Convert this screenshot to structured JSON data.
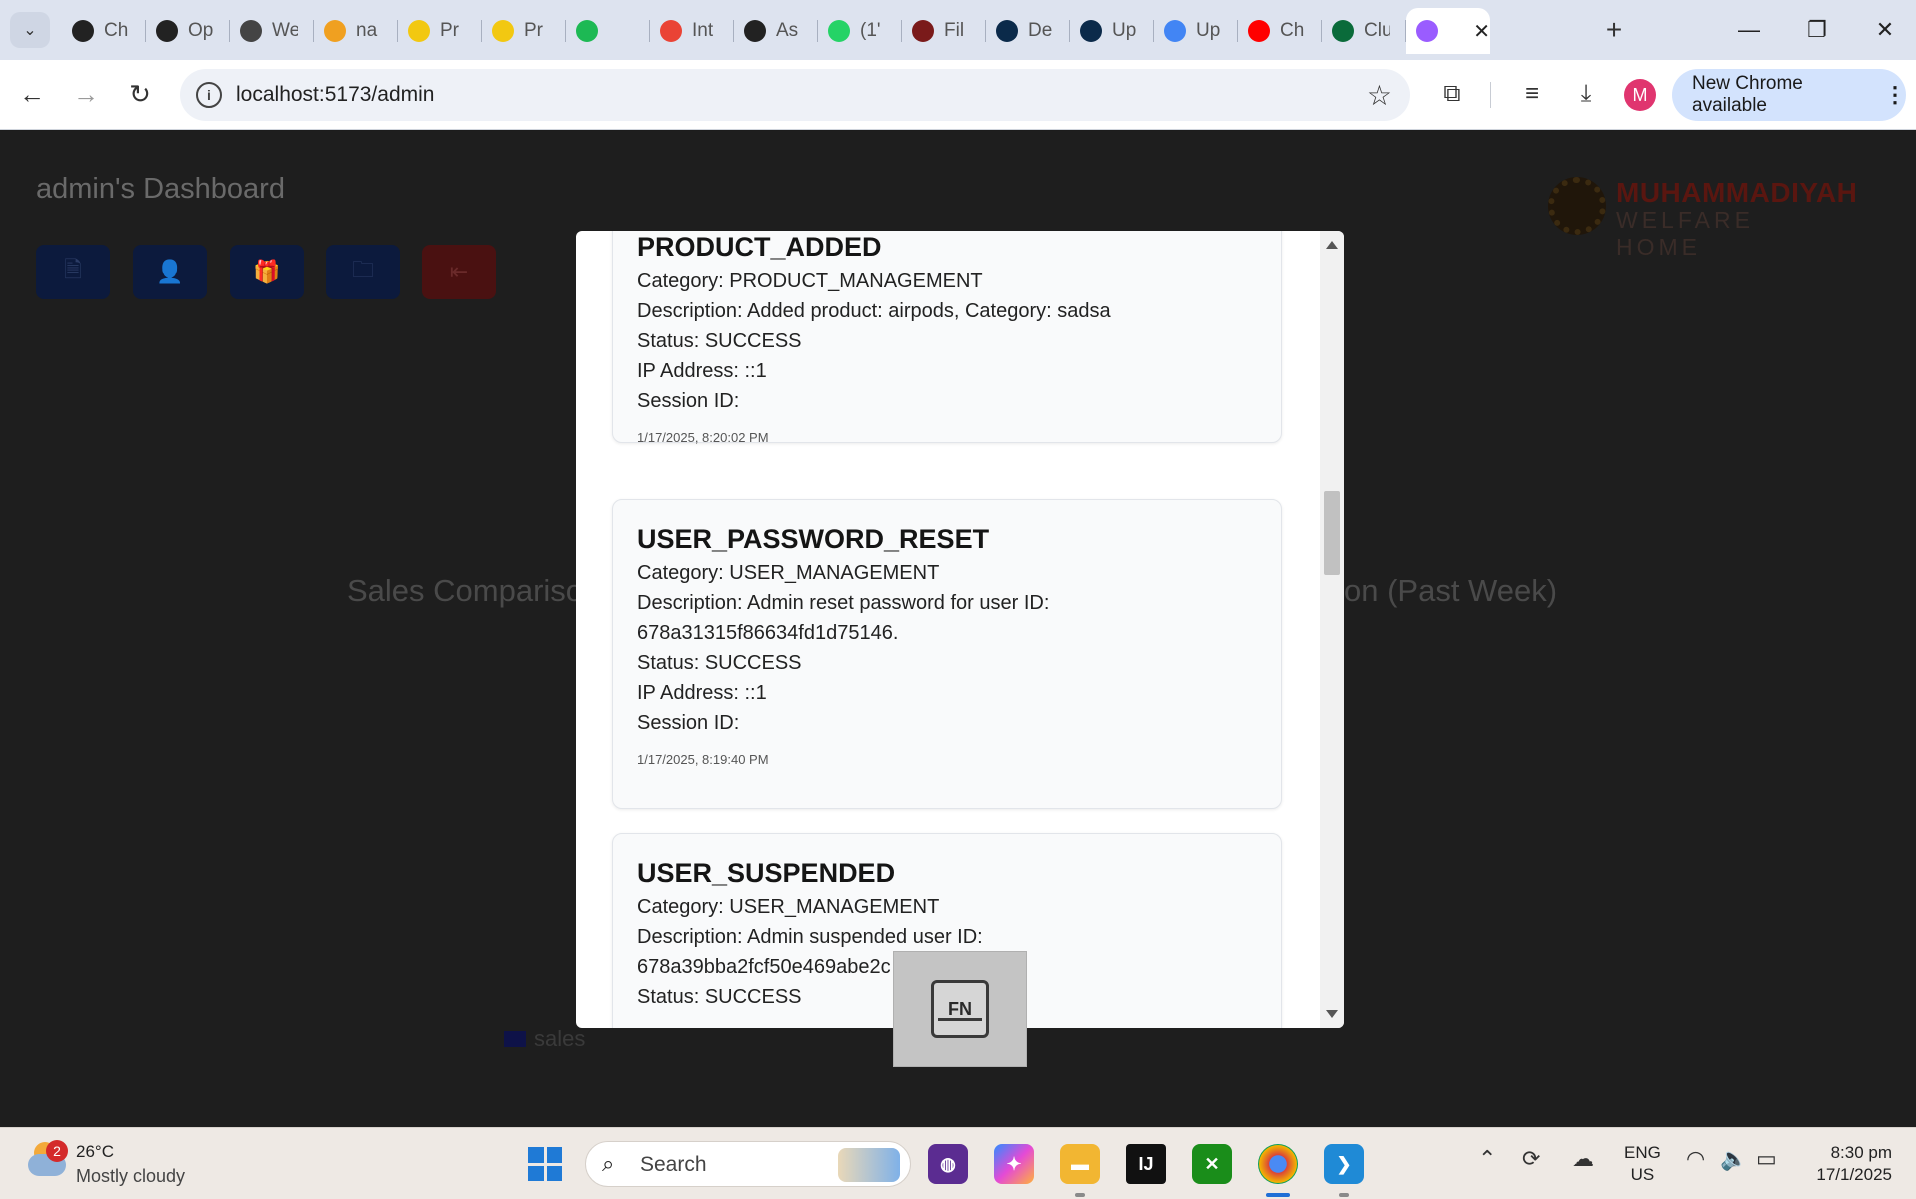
{
  "browser": {
    "tabs": [
      {
        "title": "Ch",
        "icon": "openai-icon",
        "color": "#222222"
      },
      {
        "title": "Op",
        "icon": "openai-icon",
        "color": "#222222"
      },
      {
        "title": "We",
        "icon": "globe-icon",
        "color": "#444444"
      },
      {
        "title": "na",
        "icon": "leetcode-icon",
        "color": "#f0a020"
      },
      {
        "title": "Pr",
        "icon": "powerbi-icon",
        "color": "#f2c811"
      },
      {
        "title": "Pr",
        "icon": "powerbi-icon",
        "color": "#f2c811"
      },
      {
        "title": "",
        "icon": "spotify-icon",
        "color": "#1db954"
      },
      {
        "title": "Int",
        "icon": "gmail-icon",
        "color": "#ea4335"
      },
      {
        "title": "As",
        "icon": "app-icon",
        "color": "#222222"
      },
      {
        "title": "(1'",
        "icon": "whatsapp-icon",
        "color": "#25d366"
      },
      {
        "title": "Fil",
        "icon": "school-icon",
        "color": "#7a1a1a"
      },
      {
        "title": "De",
        "icon": "d-icon",
        "color": "#0b2a4a"
      },
      {
        "title": "Up",
        "icon": "d-icon",
        "color": "#0b2a4a"
      },
      {
        "title": "Up",
        "icon": "google-icon",
        "color": "#4285f4"
      },
      {
        "title": "Ch",
        "icon": "youtube-icon",
        "color": "#ff0000"
      },
      {
        "title": "Clu",
        "icon": "mongodb-icon",
        "color": "#0a6b3a"
      },
      {
        "title": "",
        "icon": "vite-icon",
        "color": "#9a5cff",
        "active": true
      }
    ],
    "url": "localhost:5173/admin",
    "update_label": "New Chrome available",
    "profile_initial": "M"
  },
  "page": {
    "title": "admin's Dashboard",
    "logo_line1": "MUHAMMADIYAH",
    "logo_line2": "WELFARE HOME",
    "chart_title_left": "Sales Comparison",
    "chart_title_right": "on (Past Week)",
    "legend_label": "sales"
  },
  "modal": {
    "logs": [
      {
        "action": "PRODUCT_ADDED",
        "category": "Category: PRODUCT_MANAGEMENT",
        "description": "Description: Added product: airpods, Category: sadsa",
        "status": "Status: SUCCESS",
        "ip": "IP Address: ::1",
        "session": "Session ID:",
        "timestamp": "1/17/2025, 8:20:02 PM"
      },
      {
        "action": "USER_PASSWORD_RESET",
        "category": "Category: USER_MANAGEMENT",
        "description": "Description: Admin reset password for user ID:",
        "description_cont": "678a31315f86634fd1d75146.",
        "status": "Status: SUCCESS",
        "ip": "IP Address: ::1",
        "session": "Session ID:",
        "timestamp": "1/17/2025, 8:19:40 PM"
      },
      {
        "action": "USER_SUSPENDED",
        "category": "Category: USER_MANAGEMENT",
        "description": "Description: Admin suspended user ID:",
        "description_cont": "678a39bba2fcf50e469abe2c",
        "status": "Status: SUCCESS"
      }
    ],
    "fn_key_label": "FN"
  },
  "taskbar": {
    "weather_temp": "26°C",
    "weather_desc": "Mostly cloudy",
    "weather_badge": "2",
    "search_label": "Search",
    "lang_1": "ENG",
    "lang_2": "US",
    "time": "8:30 pm",
    "date": "17/1/2025"
  }
}
